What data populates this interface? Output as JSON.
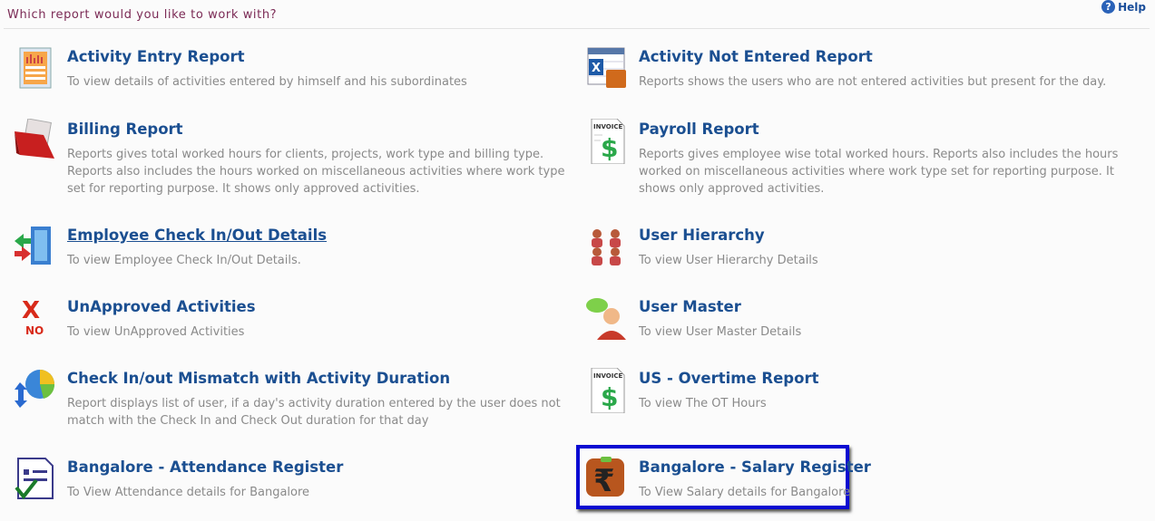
{
  "header": {
    "question": "Which report would you like to work with?",
    "help_label": "Help"
  },
  "reports": [
    {
      "title": "Activity Entry Report",
      "desc": "To view details of activities entered by himself and his subordinates",
      "icon": "chart-report-icon"
    },
    {
      "title": "Activity Not Entered Report",
      "desc": "Reports shows the users who are not entered activities but present for the day.",
      "icon": "excel-calendar-icon"
    },
    {
      "title": "Billing Report",
      "desc": "Reports gives total worked hours for clients, projects, work type and billing type. Reports also includes the hours worked on miscellaneous activities where work type set for reporting purpose. It shows only approved activities.",
      "icon": "red-folder-icon"
    },
    {
      "title": "Payroll Report",
      "desc": "Reports gives employee wise total worked hours. Reports also includes the hours worked on miscellaneous activities where work type set for reporting purpose. It shows only approved activities.",
      "icon": "invoice-dollar-icon"
    },
    {
      "title": "Employee Check In/Out Details",
      "desc": "To view Employee Check In/Out Details.",
      "icon": "door-icon"
    },
    {
      "title": "User Hierarchy",
      "desc": "To view User Hierarchy Details",
      "icon": "users-hierarchy-icon"
    },
    {
      "title": "UnApproved Activities",
      "desc": "To view UnApproved Activities",
      "icon": "x-no-icon"
    },
    {
      "title": "User Master",
      "desc": "To view User Master Details",
      "icon": "user-chat-icon"
    },
    {
      "title": "Check In/out Mismatch with Activity Duration",
      "desc": "Report displays list of user, if a day's activity duration entered by the user does not match with the Check In and Check Out duration for that day",
      "icon": "pie-chart-icon"
    },
    {
      "title": "US - Overtime Report",
      "desc": "To view The OT Hours",
      "icon": "invoice-dollar-icon"
    },
    {
      "title": "Bangalore - Attendance Register",
      "desc": "To View Attendance details for Bangalore",
      "icon": "attendance-check-icon"
    },
    {
      "title": "Bangalore - Salary Register",
      "desc": "To View Salary details for Bangalore",
      "icon": "rupee-icon"
    }
  ],
  "icon_text": {
    "invoice": "INVOICE",
    "no": "NO"
  }
}
